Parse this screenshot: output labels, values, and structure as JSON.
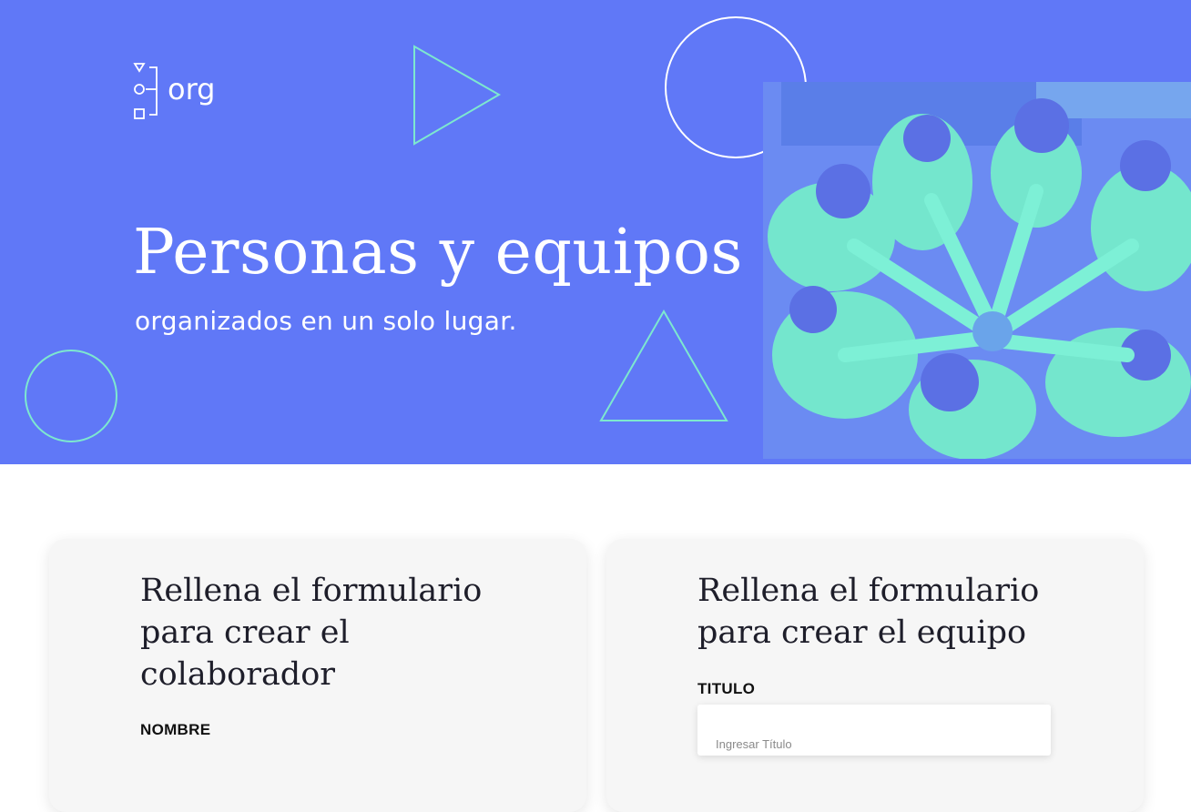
{
  "brand": {
    "logo_text": "org"
  },
  "hero": {
    "title": "Personas y equipos",
    "subtitle": "organizados en un solo lugar."
  },
  "colors": {
    "hero_background": "#6078f7",
    "accent_mint": "#7de8cf",
    "photo_tint": "#6d8ef3"
  },
  "photo": {
    "subject": "team-hands-together-photo"
  },
  "forms": {
    "collaborator": {
      "title": "Rellena el formulario para crear el colaborador",
      "title_lines": [
        "Rellena el formulario",
        "para crear el",
        "colaborador"
      ],
      "name_label": "NOMBRE"
    },
    "team": {
      "title": "Rellena el formulario para crear el equipo",
      "title_lines": [
        "Rellena el formulario",
        "para crear el equipo"
      ],
      "title_label": "TITULO",
      "title_placeholder": "Ingresar Título"
    }
  }
}
